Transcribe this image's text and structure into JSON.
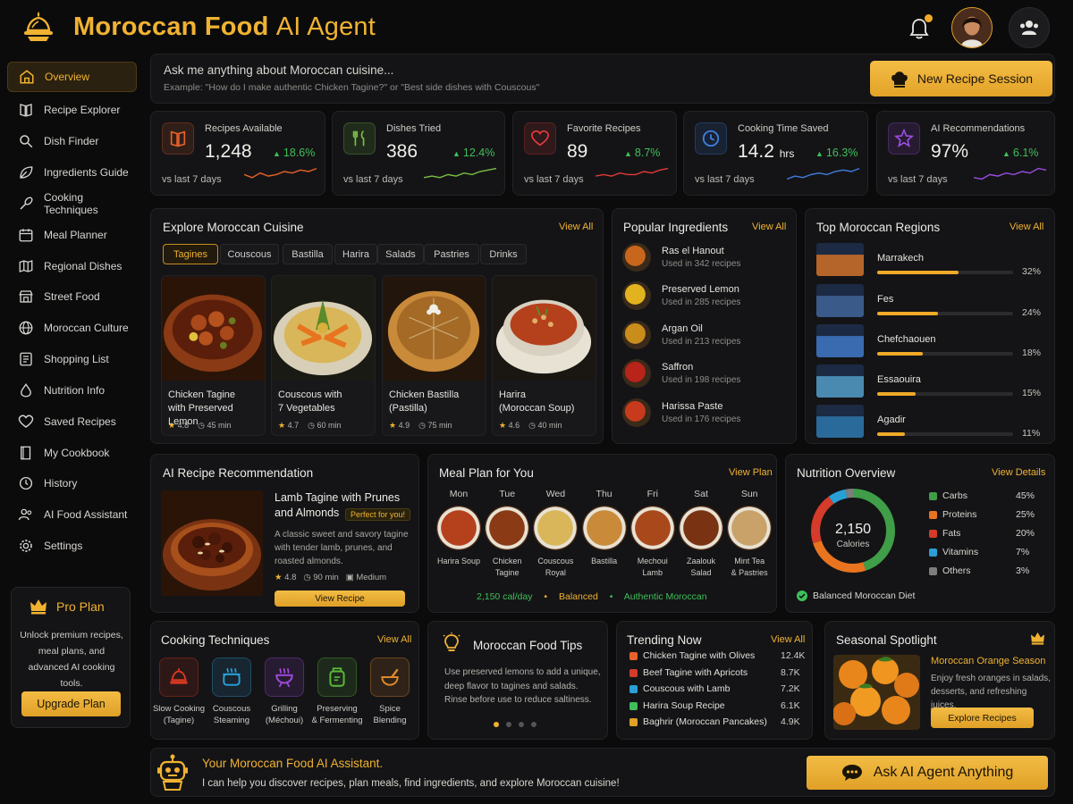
{
  "header": {
    "title_bold": "Moroccan Food",
    "title_light": "AI Agent",
    "icons": [
      "tagine-logo-icon",
      "bell-icon",
      "avatar",
      "users-icon"
    ],
    "notification_dot_color": "#f0a928"
  },
  "sidebar": {
    "items": [
      {
        "label": "Overview",
        "icon": "home-icon",
        "active": true
      },
      {
        "label": "Recipe Explorer",
        "icon": "book-icon"
      },
      {
        "label": "Dish Finder",
        "icon": "search-icon"
      },
      {
        "label": "Ingredients Guide",
        "icon": "leaf-icon"
      },
      {
        "label": "Cooking Techniques",
        "icon": "whisk-icon"
      },
      {
        "label": "Meal Planner",
        "icon": "calendar-icon"
      },
      {
        "label": "Regional Dishes",
        "icon": "map-icon"
      },
      {
        "label": "Street Food",
        "icon": "storefront-icon"
      },
      {
        "label": "Moroccan Culture",
        "icon": "globe-icon"
      },
      {
        "label": "Shopping List",
        "icon": "list-icon"
      },
      {
        "label": "Nutrition Info",
        "icon": "drop-icon"
      },
      {
        "label": "Saved Recipes",
        "icon": "heart-icon"
      },
      {
        "label": "My Cookbook",
        "icon": "cookbook-icon"
      },
      {
        "label": "History",
        "icon": "history-icon"
      },
      {
        "label": "AI Food Assistant",
        "icon": "users-icon"
      },
      {
        "label": "Settings",
        "icon": "gear-icon"
      }
    ],
    "pro": {
      "title": "Pro Plan",
      "text": "Unlock premium recipes, meal plans, and advanced AI cooking tools.",
      "button": "Upgrade Plan"
    }
  },
  "search": {
    "prompt": "Ask me anything about Moroccan cuisine...",
    "example": "Example: \"How do I make authentic Chicken Tagine?\" or \"Best side dishes with Couscous\"",
    "button": "New Recipe Session"
  },
  "stats": [
    {
      "label": "Recipes Available",
      "value": "1,248",
      "unit": "",
      "change": "18.6%",
      "sub": "vs last 7 days",
      "color": "#e8622a",
      "icon": "book-icon"
    },
    {
      "label": "Dishes Tried",
      "value": "386",
      "unit": "",
      "change": "12.4%",
      "sub": "vs last 7 days",
      "color": "#7bc043",
      "icon": "utensils-icon"
    },
    {
      "label": "Favorite Recipes",
      "value": "89",
      "unit": "",
      "change": "8.7%",
      "sub": "vs last 7 days",
      "color": "#e03a3a",
      "icon": "heart-icon"
    },
    {
      "label": "Cooking Time Saved",
      "value": "14.2",
      "unit": "hrs",
      "change": "16.3%",
      "sub": "vs last 7 days",
      "color": "#3f7fe0",
      "icon": "clock-icon"
    },
    {
      "label": "AI Recommendations",
      "value": "97%",
      "unit": "",
      "change": "6.1%",
      "sub": "vs last 7 days",
      "color": "#9a4de0",
      "icon": "star-icon"
    }
  ],
  "explore": {
    "title": "Explore Moroccan Cuisine",
    "view_all": "View All",
    "tabs": [
      "Tagines",
      "Couscous",
      "Bastilla",
      "Harira",
      "Salads",
      "Pastries",
      "Drinks"
    ],
    "dishes": [
      {
        "name1": "Chicken Tagine",
        "name2": "with Preserved Lemon",
        "rating": "4.8",
        "time": "45 min"
      },
      {
        "name1": "Couscous with",
        "name2": "7 Vegetables",
        "rating": "4.7",
        "time": "60 min"
      },
      {
        "name1": "Chicken Bastilla",
        "name2": "(Pastilla)",
        "rating": "4.9",
        "time": "75 min"
      },
      {
        "name1": "Harira",
        "name2": "(Moroccan Soup)",
        "rating": "4.6",
        "time": "40 min"
      }
    ]
  },
  "ingredients": {
    "title": "Popular Ingredients",
    "view_all": "View All",
    "items": [
      {
        "name": "Ras el Hanout",
        "sub": "Used in 342 recipes",
        "color": "#c8661d"
      },
      {
        "name": "Preserved Lemon",
        "sub": "Used in 285 recipes",
        "color": "#e3b21f"
      },
      {
        "name": "Argan Oil",
        "sub": "Used in 213 recipes",
        "color": "#c98d1c"
      },
      {
        "name": "Saffron",
        "sub": "Used in 198 recipes",
        "color": "#b8231a"
      },
      {
        "name": "Harissa Paste",
        "sub": "Used in 176 recipes",
        "color": "#c73a1c"
      }
    ]
  },
  "regions": {
    "title": "Top Moroccan Regions",
    "view_all": "View All",
    "items": [
      {
        "name": "Marrakech",
        "pct": "32%",
        "share": 0.32
      },
      {
        "name": "Fes",
        "pct": "24%",
        "share": 0.24
      },
      {
        "name": "Chefchaouen",
        "pct": "18%",
        "share": 0.18
      },
      {
        "name": "Essaouira",
        "pct": "15%",
        "share": 0.15
      },
      {
        "name": "Agadir",
        "pct": "11%",
        "share": 0.11
      }
    ]
  },
  "ai_rec": {
    "title": "AI Recipe Recommendation",
    "dish1": "Lamb Tagine with Prunes",
    "dish2": "and Almonds",
    "badge": "Perfect for you!",
    "desc": "A classic sweet and savory tagine with tender lamb, prunes, and roasted almonds.",
    "rating": "4.8",
    "time": "90 min",
    "level": "Medium",
    "button": "View Recipe"
  },
  "meal_plan": {
    "title": "Meal Plan for You",
    "view": "View Plan",
    "days": [
      {
        "day": "Mon",
        "meal1": "Harira Soup",
        "meal2": ""
      },
      {
        "day": "Tue",
        "meal1": "Chicken",
        "meal2": "Tagine"
      },
      {
        "day": "Wed",
        "meal1": "Couscous",
        "meal2": "Royal"
      },
      {
        "day": "Thu",
        "meal1": "Bastilla",
        "meal2": ""
      },
      {
        "day": "Fri",
        "meal1": "Mechoui",
        "meal2": "Lamb"
      },
      {
        "day": "Sat",
        "meal1": "Zaalouk",
        "meal2": "Salad"
      },
      {
        "day": "Sun",
        "meal1": "Mint Tea",
        "meal2": "& Pastries"
      }
    ],
    "footer": [
      "2,150 cal/day",
      "Balanced",
      "Authentic Moroccan"
    ]
  },
  "nutrition": {
    "title": "Nutrition Overview",
    "view": "View Details",
    "total": "2,150",
    "total_label": "Calories",
    "legend": [
      {
        "name": "Carbs",
        "pct": "45%",
        "share": 45,
        "color": "#3f9e47"
      },
      {
        "name": "Proteins",
        "pct": "25%",
        "share": 25,
        "color": "#e8741f"
      },
      {
        "name": "Fats",
        "pct": "20%",
        "share": 20,
        "color": "#d43b2a"
      },
      {
        "name": "Vitamins",
        "pct": "7%",
        "share": 7,
        "color": "#2a9fd6"
      },
      {
        "name": "Others",
        "pct": "3%",
        "share": 3,
        "color": "#7d7d7d"
      }
    ],
    "footer": "Balanced Moroccan Diet"
  },
  "techniques": {
    "title": "Cooking Techniques",
    "view_all": "View All",
    "items": [
      {
        "l1": "Slow Cooking",
        "l2": "(Tagine)",
        "color": "#d7381f",
        "icon": "tagine-pot-icon"
      },
      {
        "l1": "Couscous",
        "l2": "Steaming",
        "color": "#2a9fd6",
        "icon": "steamer-icon"
      },
      {
        "l1": "Grilling",
        "l2": "(Méchoui)",
        "color": "#a34ae0",
        "icon": "grill-icon"
      },
      {
        "l1": "Preserving",
        "l2": "& Fermenting",
        "color": "#5cb83a",
        "icon": "jar-icon"
      },
      {
        "l1": "Spice",
        "l2": "Blending",
        "color": "#e0892a",
        "icon": "mortar-icon"
      }
    ]
  },
  "tips": {
    "title": "Moroccan Food Tips",
    "text": "Use preserved lemons to add a unique, deep flavor to tagines and salads. Rinse before use to reduce saltiness.",
    "icon": "lightbulb-icon"
  },
  "trending": {
    "title": "Trending Now",
    "view_all": "View All",
    "items": [
      {
        "name": "Chicken Tagine with Olives",
        "value": "12.4K",
        "color": "#e8622a"
      },
      {
        "name": "Beef Tagine with Apricots",
        "value": "8.7K",
        "color": "#d43b2a"
      },
      {
        "name": "Couscous with Lamb",
        "value": "7.2K",
        "color": "#2a9fd6"
      },
      {
        "name": "Harira Soup Recipe",
        "value": "6.1K",
        "color": "#3fbf5a"
      },
      {
        "name": "Baghrir (Moroccan Pancakes)",
        "value": "4.9K",
        "color": "#e0a027"
      }
    ]
  },
  "seasonal": {
    "title": "Seasonal Spotlight",
    "subtitle": "Moroccan Orange Season",
    "text": "Enjoy fresh oranges in salads, desserts, and refreshing juices.",
    "button": "Explore Recipes"
  },
  "assistant": {
    "title": "Your Moroccan Food AI Assistant.",
    "text": "I can help you discover recipes, plan meals, find ingredients, and explore Moroccan cuisine!",
    "button": "Ask AI Agent Anything"
  }
}
